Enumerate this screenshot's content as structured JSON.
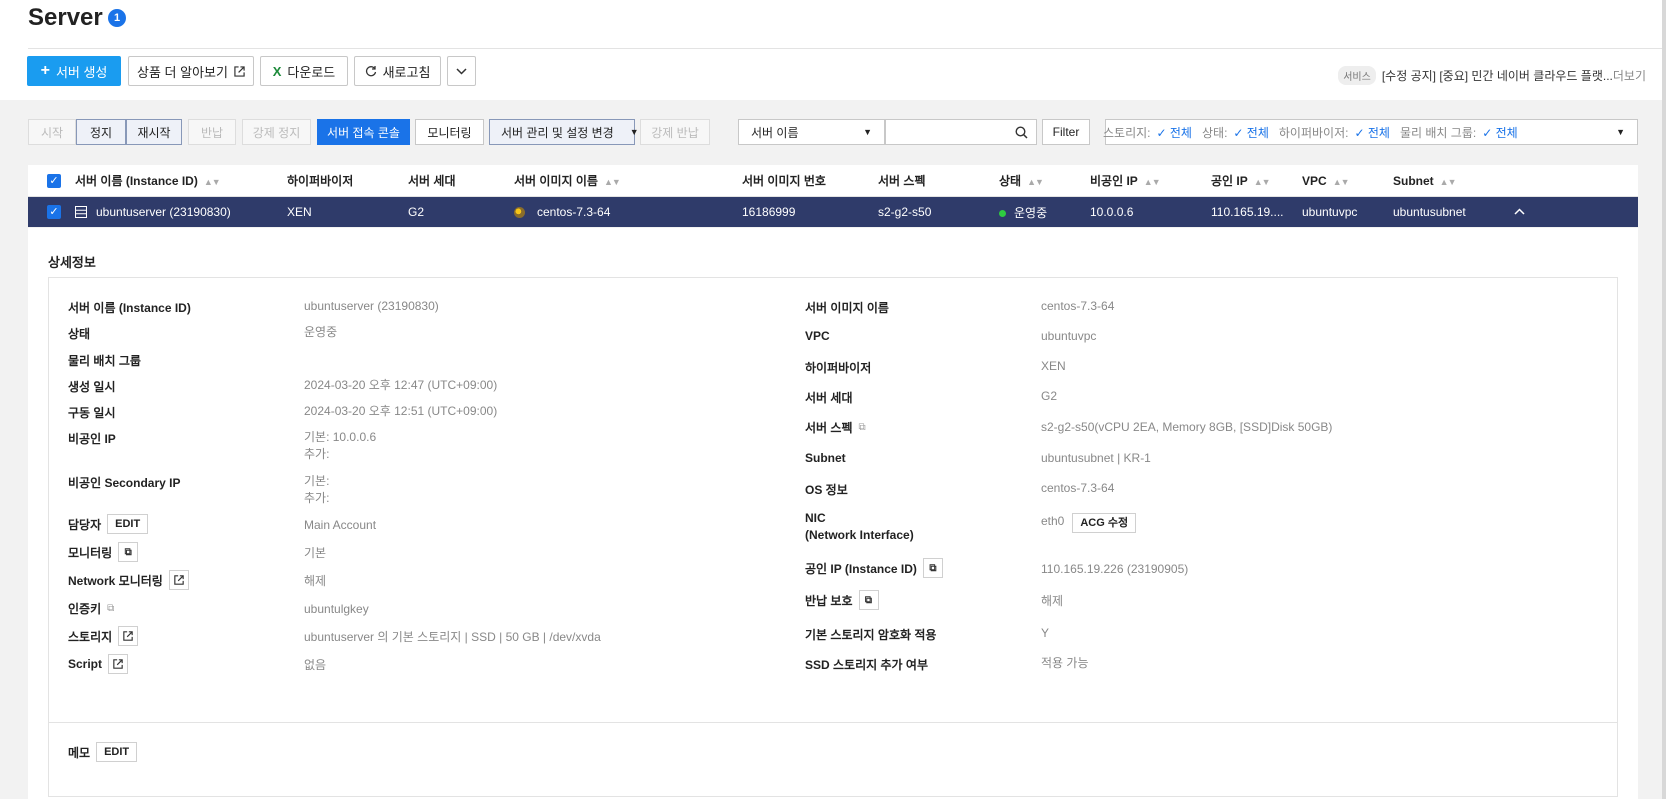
{
  "header": {
    "title": "Server",
    "badge": "1",
    "buttons": {
      "create": "서버 생성",
      "learn_more": "상품 더 알아보기",
      "download": "다운로드",
      "refresh": "새로고침"
    },
    "notice": {
      "tag": "서비스",
      "text": "[수정 공지] [중요] 민간 네이버 클라우드 플랫...",
      "more": "더보기"
    }
  },
  "toolbar": {
    "start": "시작",
    "stop": "정지",
    "restart": "재시작",
    "return": "반납",
    "force_stop": "강제 정지",
    "console": "서버 접속 콘솔",
    "monitoring": "모니터링",
    "manage": "서버 관리 및 설정 변경",
    "force_return": "강제 반납",
    "search_field": "서버 이름",
    "search_placeholder": "",
    "filter": "Filter",
    "filters": [
      {
        "label": "스토리지:",
        "value": "전체"
      },
      {
        "label": "상태:",
        "value": "전체"
      },
      {
        "label": "하이퍼바이저:",
        "value": "전체"
      },
      {
        "label": "물리 배치 그룹:",
        "value": "전체"
      }
    ]
  },
  "table": {
    "columns": [
      "서버 이름 (Instance ID)",
      "하이퍼바이저",
      "서버 세대",
      "서버 이미지 이름",
      "서버 이미지 번호",
      "서버 스펙",
      "상태",
      "비공인 IP",
      "공인 IP",
      "VPC",
      "Subnet"
    ],
    "row": {
      "name": "ubuntuserver (23190830)",
      "hypervisor": "XEN",
      "generation": "G2",
      "image_name": "centos-7.3-64",
      "image_no": "16186999",
      "spec": "s2-g2-s50",
      "status": "운영중",
      "private_ip": "10.0.0.6",
      "public_ip": "110.165.19....",
      "vpc": "ubuntuvpc",
      "subnet": "ubuntusubnet"
    }
  },
  "detail": {
    "title": "상세정보",
    "left": {
      "name_label": "서버 이름 (Instance ID)",
      "name_value": "ubuntuserver (23190830)",
      "status_label": "상태",
      "status_value": "운영중",
      "placement_label": "물리 배치 그룹",
      "created_label": "생성 일시",
      "created_value": "2024-03-20 오후 12:47 (UTC+09:00)",
      "started_label": "구동 일시",
      "started_value": "2024-03-20 오후 12:51 (UTC+09:00)",
      "private_ip_label": "비공인 IP",
      "private_ip_main": "기본: 10.0.0.6",
      "private_ip_extra": "추가:",
      "secondary_label": "비공인 Secondary IP",
      "secondary_main": "기본:",
      "secondary_extra": "추가:",
      "owner_label": "담당자",
      "owner_edit": "EDIT",
      "owner_value": "Main Account",
      "monitoring_label": "모니터링",
      "monitoring_value": "기본",
      "net_monitoring_label": "Network 모니터링",
      "net_monitoring_value": "해제",
      "authkey_label": "인증키",
      "authkey_value": "ubuntulgkey",
      "storage_label": "스토리지",
      "storage_value": "ubuntuserver 의 기본 스토리지 | SSD | 50 GB | /dev/xvda",
      "script_label": "Script",
      "script_value": "없음"
    },
    "right": {
      "image_label": "서버 이미지 이름",
      "image_value": "centos-7.3-64",
      "vpc_label": "VPC",
      "vpc_value": "ubuntuvpc",
      "hypervisor_label": "하이퍼바이저",
      "hypervisor_value": "XEN",
      "generation_label": "서버 세대",
      "generation_value": "G2",
      "spec_label": "서버 스펙",
      "spec_value": "s2-g2-s50(vCPU 2EA, Memory 8GB, [SSD]Disk 50GB)",
      "subnet_label": "Subnet",
      "subnet_value": "ubuntusubnet | KR-1",
      "os_label": "OS 정보",
      "os_value": "centos-7.3-64",
      "nic_label1": "NIC",
      "nic_label2": "(Network Interface)",
      "nic_value": "eth0",
      "nic_btn": "ACG 수정",
      "public_ip_label": "공인 IP (Instance ID)",
      "public_ip_value": "110.165.19.226 (23190905)",
      "return_protect_label": "반납 보호",
      "return_protect_value": "해제",
      "encrypt_label": "기본 스토리지 암호화 적용",
      "encrypt_value": "Y",
      "ssd_label": "SSD 스토리지 추가 여부",
      "ssd_value": "적용 가능"
    },
    "memo_label": "메모",
    "memo_edit": "EDIT"
  },
  "colors": {
    "primary": "#1a9cf0",
    "row_selected": "#2f3b6a",
    "link": "#1a73e8",
    "status_running": "#2ecc40"
  }
}
